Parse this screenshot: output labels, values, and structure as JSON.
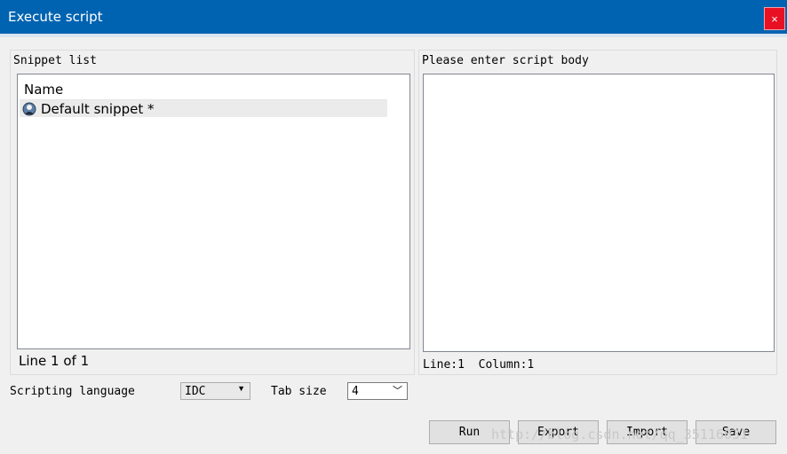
{
  "window": {
    "title": "Execute script",
    "close_glyph": "×"
  },
  "snippets": {
    "group_label": "Snippet list",
    "column_header": "Name",
    "items": [
      {
        "label": "Default snippet *",
        "icon": "snippet-icon"
      }
    ],
    "status": "Line 1 of 1"
  },
  "editor": {
    "group_label": "Please enter script body",
    "content": "",
    "status": "Line:1  Column:1"
  },
  "options": {
    "language_label": "Scripting language",
    "language_value": "IDC",
    "tab_size_label": "Tab size",
    "tab_size_value": "4"
  },
  "buttons": {
    "run": "Run",
    "export": "Export",
    "import": "Import",
    "save": "Save"
  },
  "watermark": "http://blog.csdn.net/qq_35116031",
  "colors": {
    "titlebar": "#0063b1",
    "close": "#e81123",
    "selection": "#ebebeb"
  }
}
